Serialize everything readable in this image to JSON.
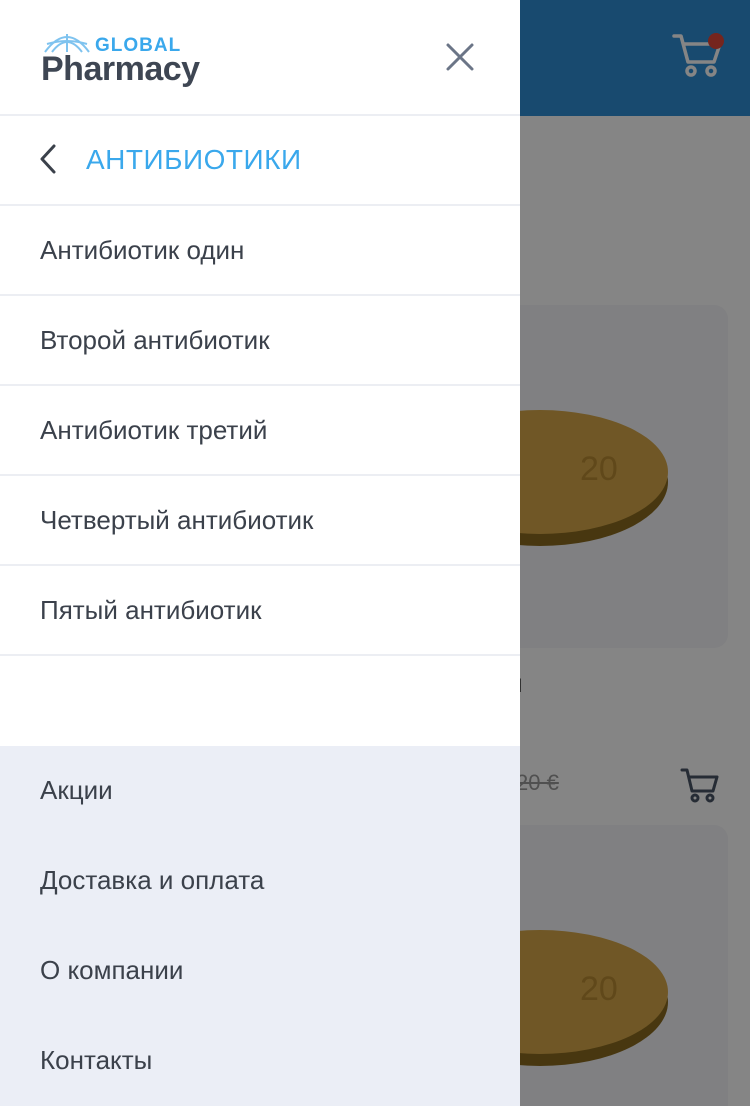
{
  "brand": {
    "logo_top": "GLOBAL",
    "logo_bottom": "Pharmacy"
  },
  "colors": {
    "accent": "#3aa8ec",
    "header_bg": "#2f8fd5",
    "footer_bg": "#ebeef6",
    "badge": "#e0473a"
  },
  "icons": {
    "close": "close-icon",
    "back": "chevron-left-icon",
    "cart": "cart-icon"
  },
  "drawer": {
    "category_title": "АНТИБИОТИКИ",
    "subcategories": [
      "Антибиотик один",
      "Второй антибиотик",
      "Антибиотик третий",
      "Четвертый антибиотик",
      "Пятый антибиотик"
    ],
    "footer_links": [
      "Акции",
      "Доставка и оплата",
      "О компании",
      "Контакты"
    ]
  },
  "background": {
    "product_title_fragment": "и",
    "old_price": "20 €",
    "pill_imprint": "20"
  }
}
